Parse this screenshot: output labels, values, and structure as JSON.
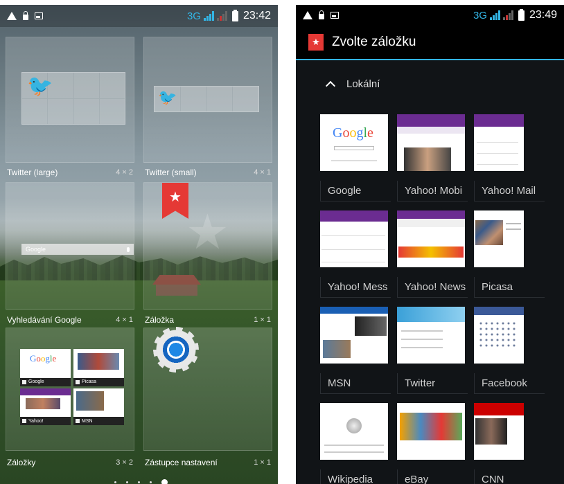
{
  "left": {
    "status": {
      "network": "3G",
      "time": "23:42"
    },
    "widgets": [
      {
        "name": "Twitter (large)",
        "size": "4 × 2"
      },
      {
        "name": "Twitter (small)",
        "size": "4 × 1"
      },
      {
        "name": "Vyhledávání Google",
        "size": "4 × 1",
        "search_text": "Google"
      },
      {
        "name": "Záložka",
        "size": "1 × 1"
      },
      {
        "name": "Záložky",
        "size": "3 × 2",
        "thumbs": [
          "Google",
          "Picasa",
          "Yahoo!",
          "MSN"
        ]
      },
      {
        "name": "Zástupce nastavení",
        "size": "1 × 1"
      }
    ],
    "page_dots": 5,
    "active_dot": 4
  },
  "right": {
    "status": {
      "network": "3G",
      "time": "23:49"
    },
    "title": "Zvolte záložku",
    "section": "Lokální",
    "bookmarks": [
      "Google",
      "Yahoo! Mobi",
      "Yahoo! Mail",
      "Yahoo! Mess",
      "Yahoo! News",
      "Picasa",
      "MSN",
      "Twitter",
      "Facebook",
      "Wikipedia",
      "eBay",
      "CNN"
    ]
  },
  "colors": {
    "accent": "#33b5e5",
    "bookmark_red": "#e53935"
  }
}
